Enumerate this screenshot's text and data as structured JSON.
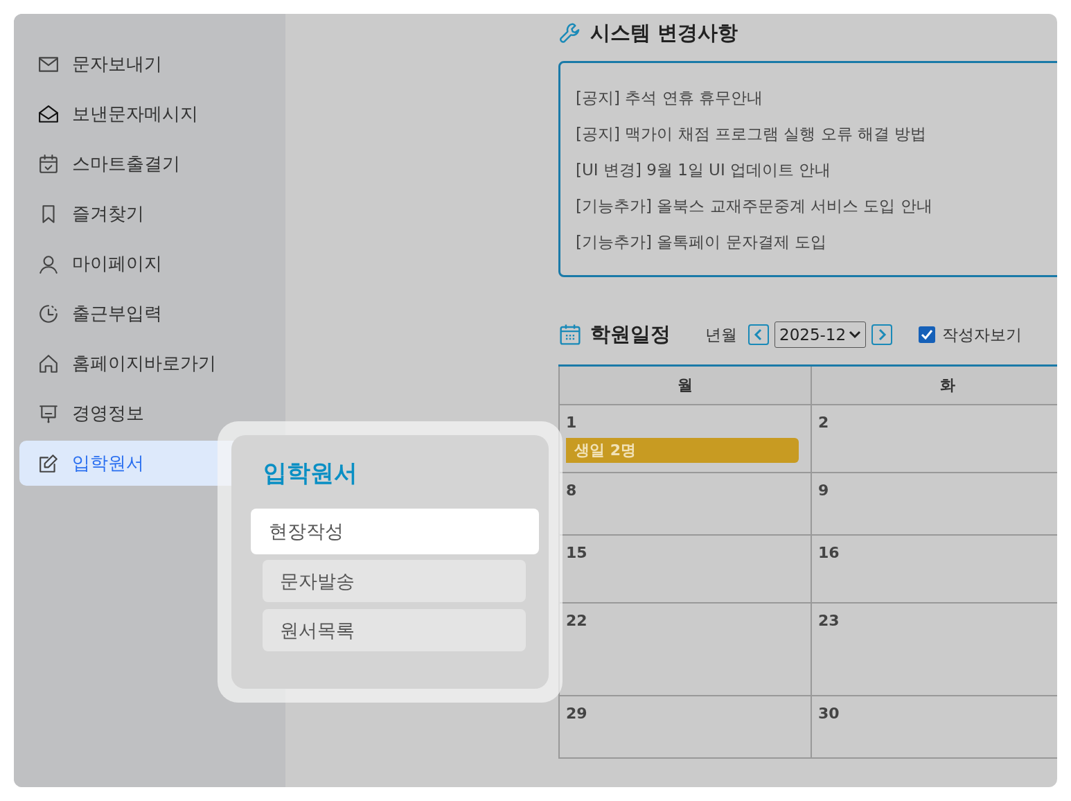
{
  "sidebar": {
    "items": [
      {
        "label": "문자보내기",
        "selected": false
      },
      {
        "label": "보낸문자메시지",
        "selected": false
      },
      {
        "label": "스마트출결기",
        "selected": false
      },
      {
        "label": "즐겨찾기",
        "selected": false
      },
      {
        "label": "마이페이지",
        "selected": false
      },
      {
        "label": "출근부입력",
        "selected": false
      },
      {
        "label": "홈페이지바로가기",
        "selected": false
      },
      {
        "label": "경영정보",
        "selected": false
      },
      {
        "label": "입학원서",
        "selected": true
      }
    ]
  },
  "notices": {
    "title": "시스템 변경사항",
    "items": [
      "[공지] 추석 연휴 휴무안내",
      "[공지] 맥가이 채점 프로그램 실행 오류 해결 방법",
      "[UI 변경] 9월 1일 UI 업데이트 안내",
      "[기능추가] 올북스 교재주문중계 서비스 도입 안내",
      "[기능추가] 올톡페이 문자결제 도입"
    ]
  },
  "schedule": {
    "title": "학원일정",
    "month_label": "년월",
    "month_value": "2025-12",
    "show_author": {
      "label": "작성자보기",
      "checked": true
    },
    "calendar": {
      "columns": [
        "월",
        "화"
      ],
      "weeks": [
        [
          {
            "day": "1",
            "events": [
              "생일 2명"
            ]
          },
          {
            "day": "2"
          }
        ],
        [
          {
            "day": "8"
          },
          {
            "day": "9"
          }
        ],
        [
          {
            "day": "15"
          },
          {
            "day": "16"
          }
        ],
        [
          {
            "day": "22"
          },
          {
            "day": "23"
          }
        ],
        [
          {
            "day": "29"
          },
          {
            "day": "30"
          }
        ]
      ]
    }
  },
  "popup": {
    "title": "입학원서",
    "items": [
      {
        "label": "현장작성",
        "selected": true
      },
      {
        "label": "문자발송",
        "selected": false
      },
      {
        "label": "원서목록",
        "selected": false
      }
    ]
  }
}
